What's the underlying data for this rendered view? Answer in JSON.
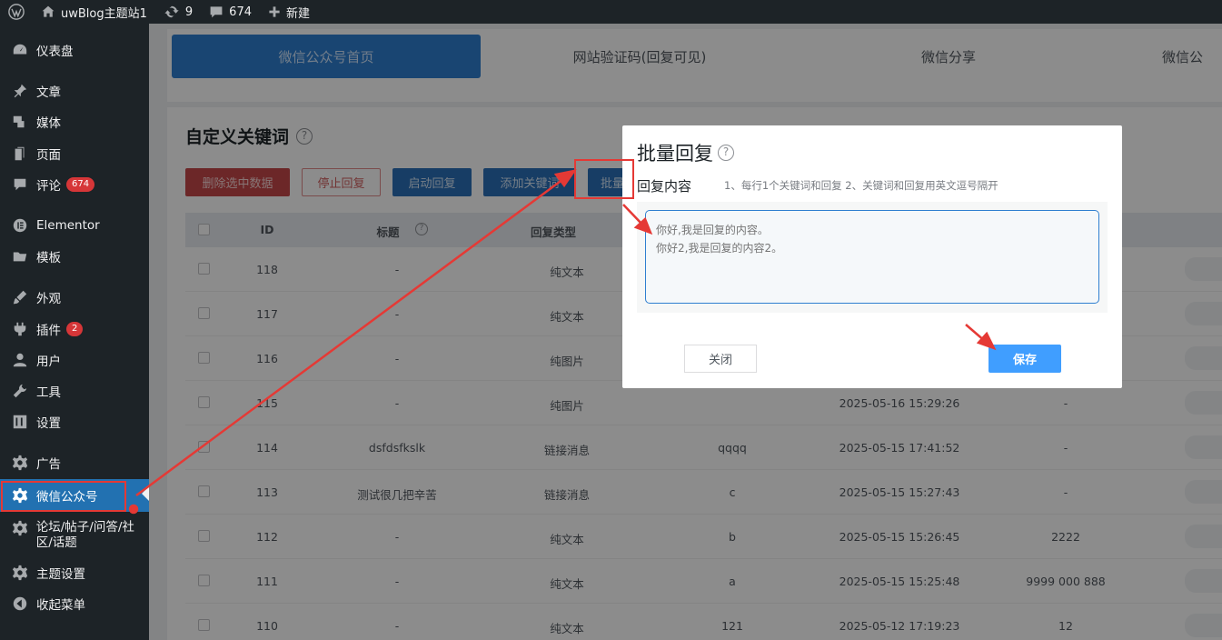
{
  "adminbar": {
    "site_name": "uwBlog主题站1",
    "updates_count": "9",
    "comments_count": "674",
    "new_label": "新建"
  },
  "sidebar": {
    "items": [
      {
        "label": "仪表盘",
        "icon": "dashboard-icon"
      },
      {
        "label": "文章",
        "icon": "pin-icon"
      },
      {
        "label": "媒体",
        "icon": "media-icon"
      },
      {
        "label": "页面",
        "icon": "page-icon"
      },
      {
        "label": "评论",
        "icon": "comment-icon",
        "badge": "674"
      },
      {
        "label": "Elementor",
        "icon": "elementor-icon"
      },
      {
        "label": "模板",
        "icon": "folder-icon"
      },
      {
        "label": "外观",
        "icon": "brush-icon"
      },
      {
        "label": "插件",
        "icon": "plugin-icon",
        "badge": "2"
      },
      {
        "label": "用户",
        "icon": "user-icon"
      },
      {
        "label": "工具",
        "icon": "wrench-icon"
      },
      {
        "label": "设置",
        "icon": "settings-icon"
      },
      {
        "label": "广告",
        "icon": "gear-icon"
      },
      {
        "label": "微信公众号",
        "icon": "gear-icon"
      },
      {
        "label": "论坛/帖子/问答/社区/话题",
        "icon": "gear-icon"
      },
      {
        "label": "主题设置",
        "icon": "gear-icon"
      },
      {
        "label": "收起菜单",
        "icon": "collapse-icon"
      }
    ]
  },
  "tabs": [
    {
      "label": "微信公众号首页"
    },
    {
      "label": "网站验证码(回复可见)"
    },
    {
      "label": "微信分享"
    },
    {
      "label": "微信公"
    }
  ],
  "section": {
    "title": "自定义关键词",
    "buttons": {
      "delete": "删除选中数据",
      "stop": "停止回复",
      "start": "启动回复",
      "add": "添加关键词",
      "batch": "批量"
    }
  },
  "table": {
    "headers": {
      "id": "ID",
      "title": "标题",
      "type": "回复类型"
    },
    "rows": [
      {
        "id": "118",
        "title": "-",
        "type": "纯文本",
        "keyword": "",
        "time": "",
        "extra": ""
      },
      {
        "id": "117",
        "title": "-",
        "type": "纯文本",
        "keyword": "",
        "time": "",
        "extra": ""
      },
      {
        "id": "116",
        "title": "-",
        "type": "纯图片",
        "keyword": "",
        "time": "",
        "extra": ""
      },
      {
        "id": "115",
        "title": "-",
        "type": "纯图片",
        "keyword": "",
        "time": "2025-05-16 15:29:26",
        "extra": "-"
      },
      {
        "id": "114",
        "title": "dsfdsfkslk",
        "type": "链接消息",
        "keyword": "qqqq",
        "time": "2025-05-15 17:41:52",
        "extra": "-"
      },
      {
        "id": "113",
        "title": "测试很几把辛苦",
        "type": "链接消息",
        "keyword": "c",
        "time": "2025-05-15 15:27:43",
        "extra": "-"
      },
      {
        "id": "112",
        "title": "-",
        "type": "纯文本",
        "keyword": "b",
        "time": "2025-05-15 15:26:45",
        "extra": "2222"
      },
      {
        "id": "111",
        "title": "-",
        "type": "纯文本",
        "keyword": "a",
        "time": "2025-05-15 15:25:48",
        "extra": "9999 000 888"
      },
      {
        "id": "110",
        "title": "-",
        "type": "纯文本",
        "keyword": "121",
        "time": "2025-05-12 17:19:23",
        "extra": "12"
      }
    ]
  },
  "modal": {
    "title": "批量回复",
    "label": "回复内容",
    "hint": "1、每行1个关键词和回复 2、关键词和回复用英文逗号隔开",
    "placeholder": "你好,我是回复的内容。\n你好2,我是回复的内容2。",
    "close_label": "关闭",
    "save_label": "保存"
  },
  "colors": {
    "accent": "#2271b1",
    "annotation": "#e53935",
    "save": "#409eff"
  }
}
